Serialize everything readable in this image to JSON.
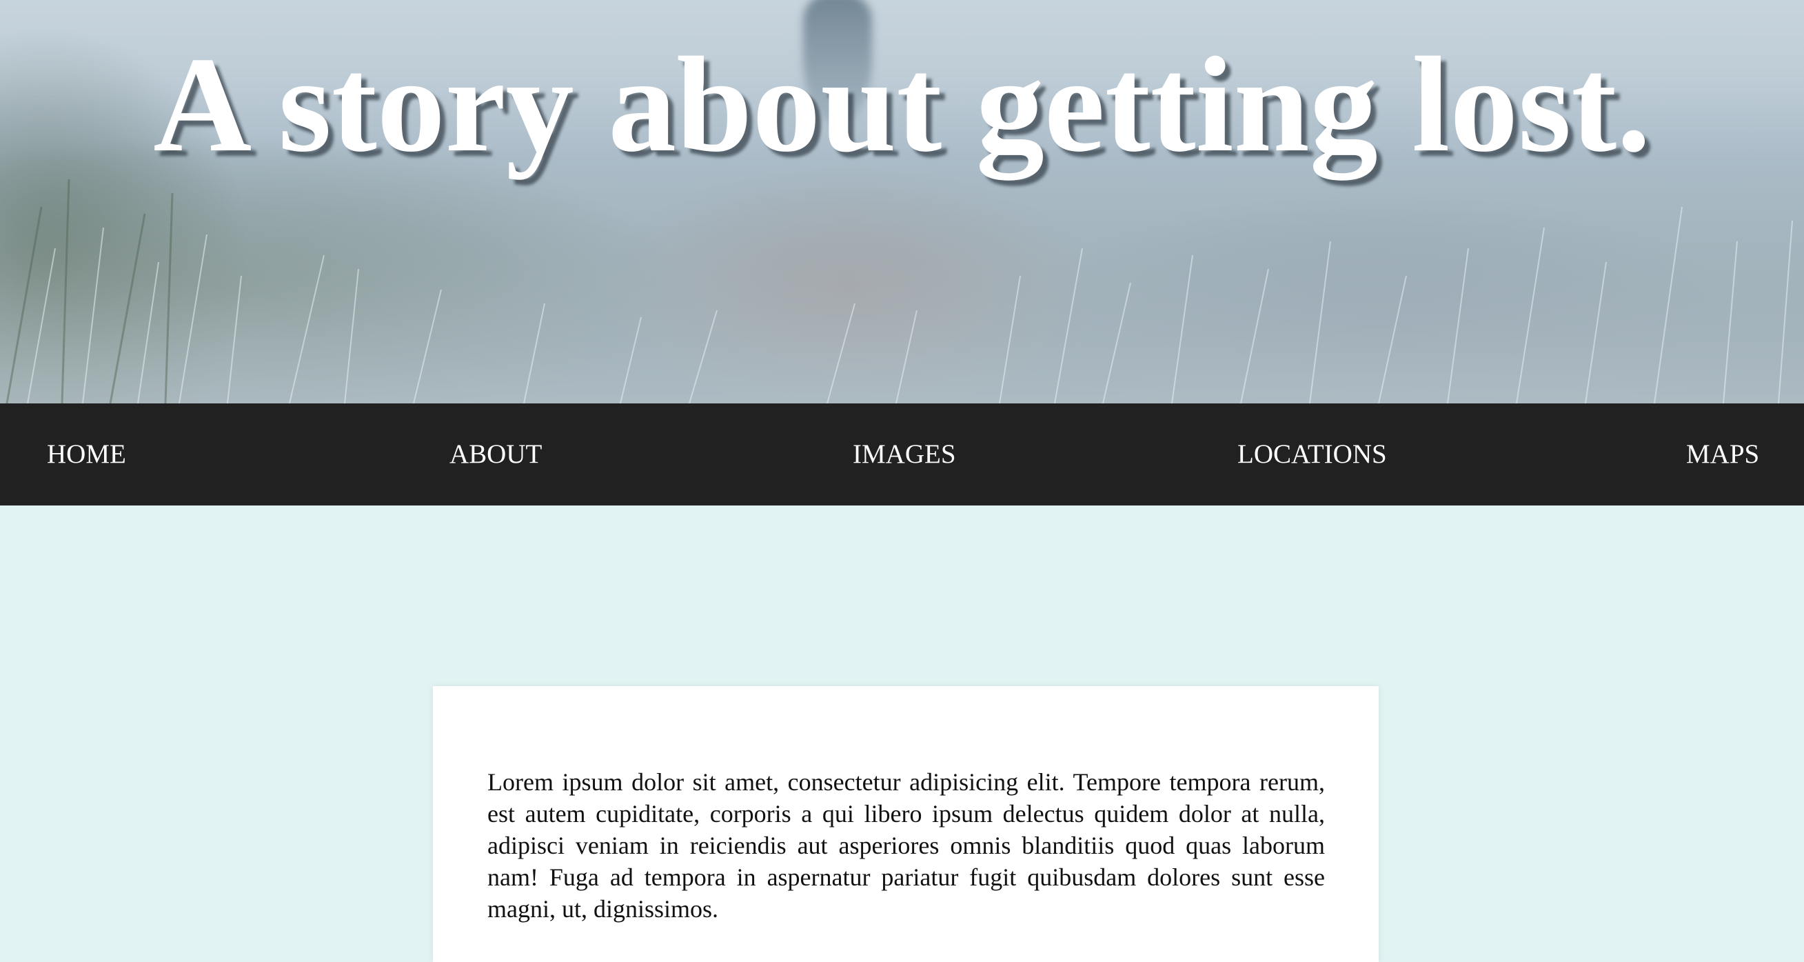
{
  "hero": {
    "title": "A story about getting lost."
  },
  "nav": {
    "items": [
      {
        "label": "HOME"
      },
      {
        "label": "ABOUT"
      },
      {
        "label": "IMAGES"
      },
      {
        "label": "LOCATIONS"
      },
      {
        "label": "MAPS"
      }
    ]
  },
  "content": {
    "paragraph": "Lorem ipsum dolor sit amet, consectetur adipisicing elit. Tempore tempora rerum, est autem cupiditate, corporis a qui libero ipsum delectus quidem dolor at nulla, adipisci veniam in reiciendis aut asperiores omnis blanditiis quod quas laborum nam! Fuga ad tempora in aspernatur pariatur fugit quibusdam dolores sunt esse magni, ut, dignissimos."
  },
  "colors": {
    "page_background": "#e1f4f3",
    "nav_background": "#212121",
    "nav_text": "#ffffff",
    "card_background": "#ffffff",
    "title_text": "#ffffff"
  }
}
